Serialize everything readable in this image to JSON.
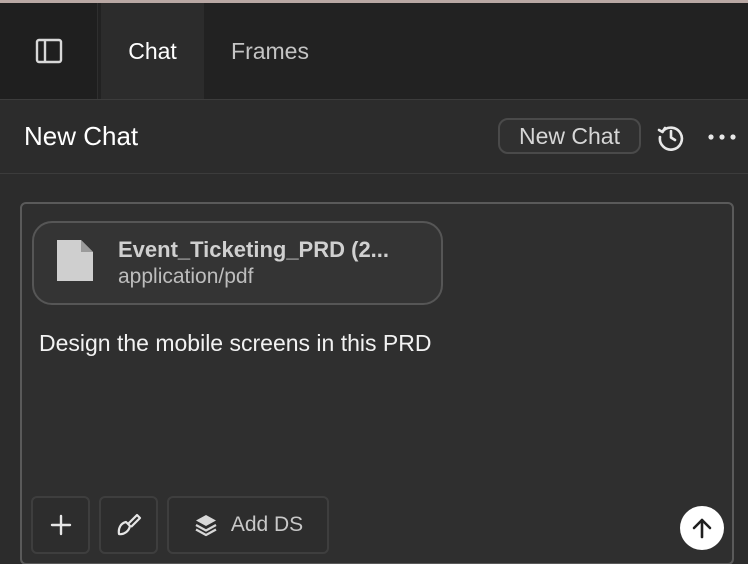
{
  "tabs": {
    "sidebar_toggle_icon": "sidebar-panel-icon",
    "items": [
      {
        "label": "Chat",
        "active": true
      },
      {
        "label": "Frames",
        "active": false
      }
    ]
  },
  "header": {
    "title": "New Chat",
    "new_chat_button": "New Chat",
    "history_icon": "history-icon",
    "more_icon": "more-horizontal-icon"
  },
  "composer": {
    "attachment": {
      "icon": "file-icon",
      "name": "Event_Ticketing_PRD (2...",
      "type": "application/pdf"
    },
    "message": "Design the mobile screens in this PRD",
    "toolbar": {
      "add_icon": "plus-icon",
      "brush_icon": "brush-icon",
      "add_ds_icon": "layers-icon",
      "add_ds_label": "Add DS"
    },
    "send_icon": "arrow-up-icon"
  },
  "colors": {
    "background": "#2c2c2c",
    "tabbar": "#222222",
    "accent_white": "#ffffff"
  }
}
